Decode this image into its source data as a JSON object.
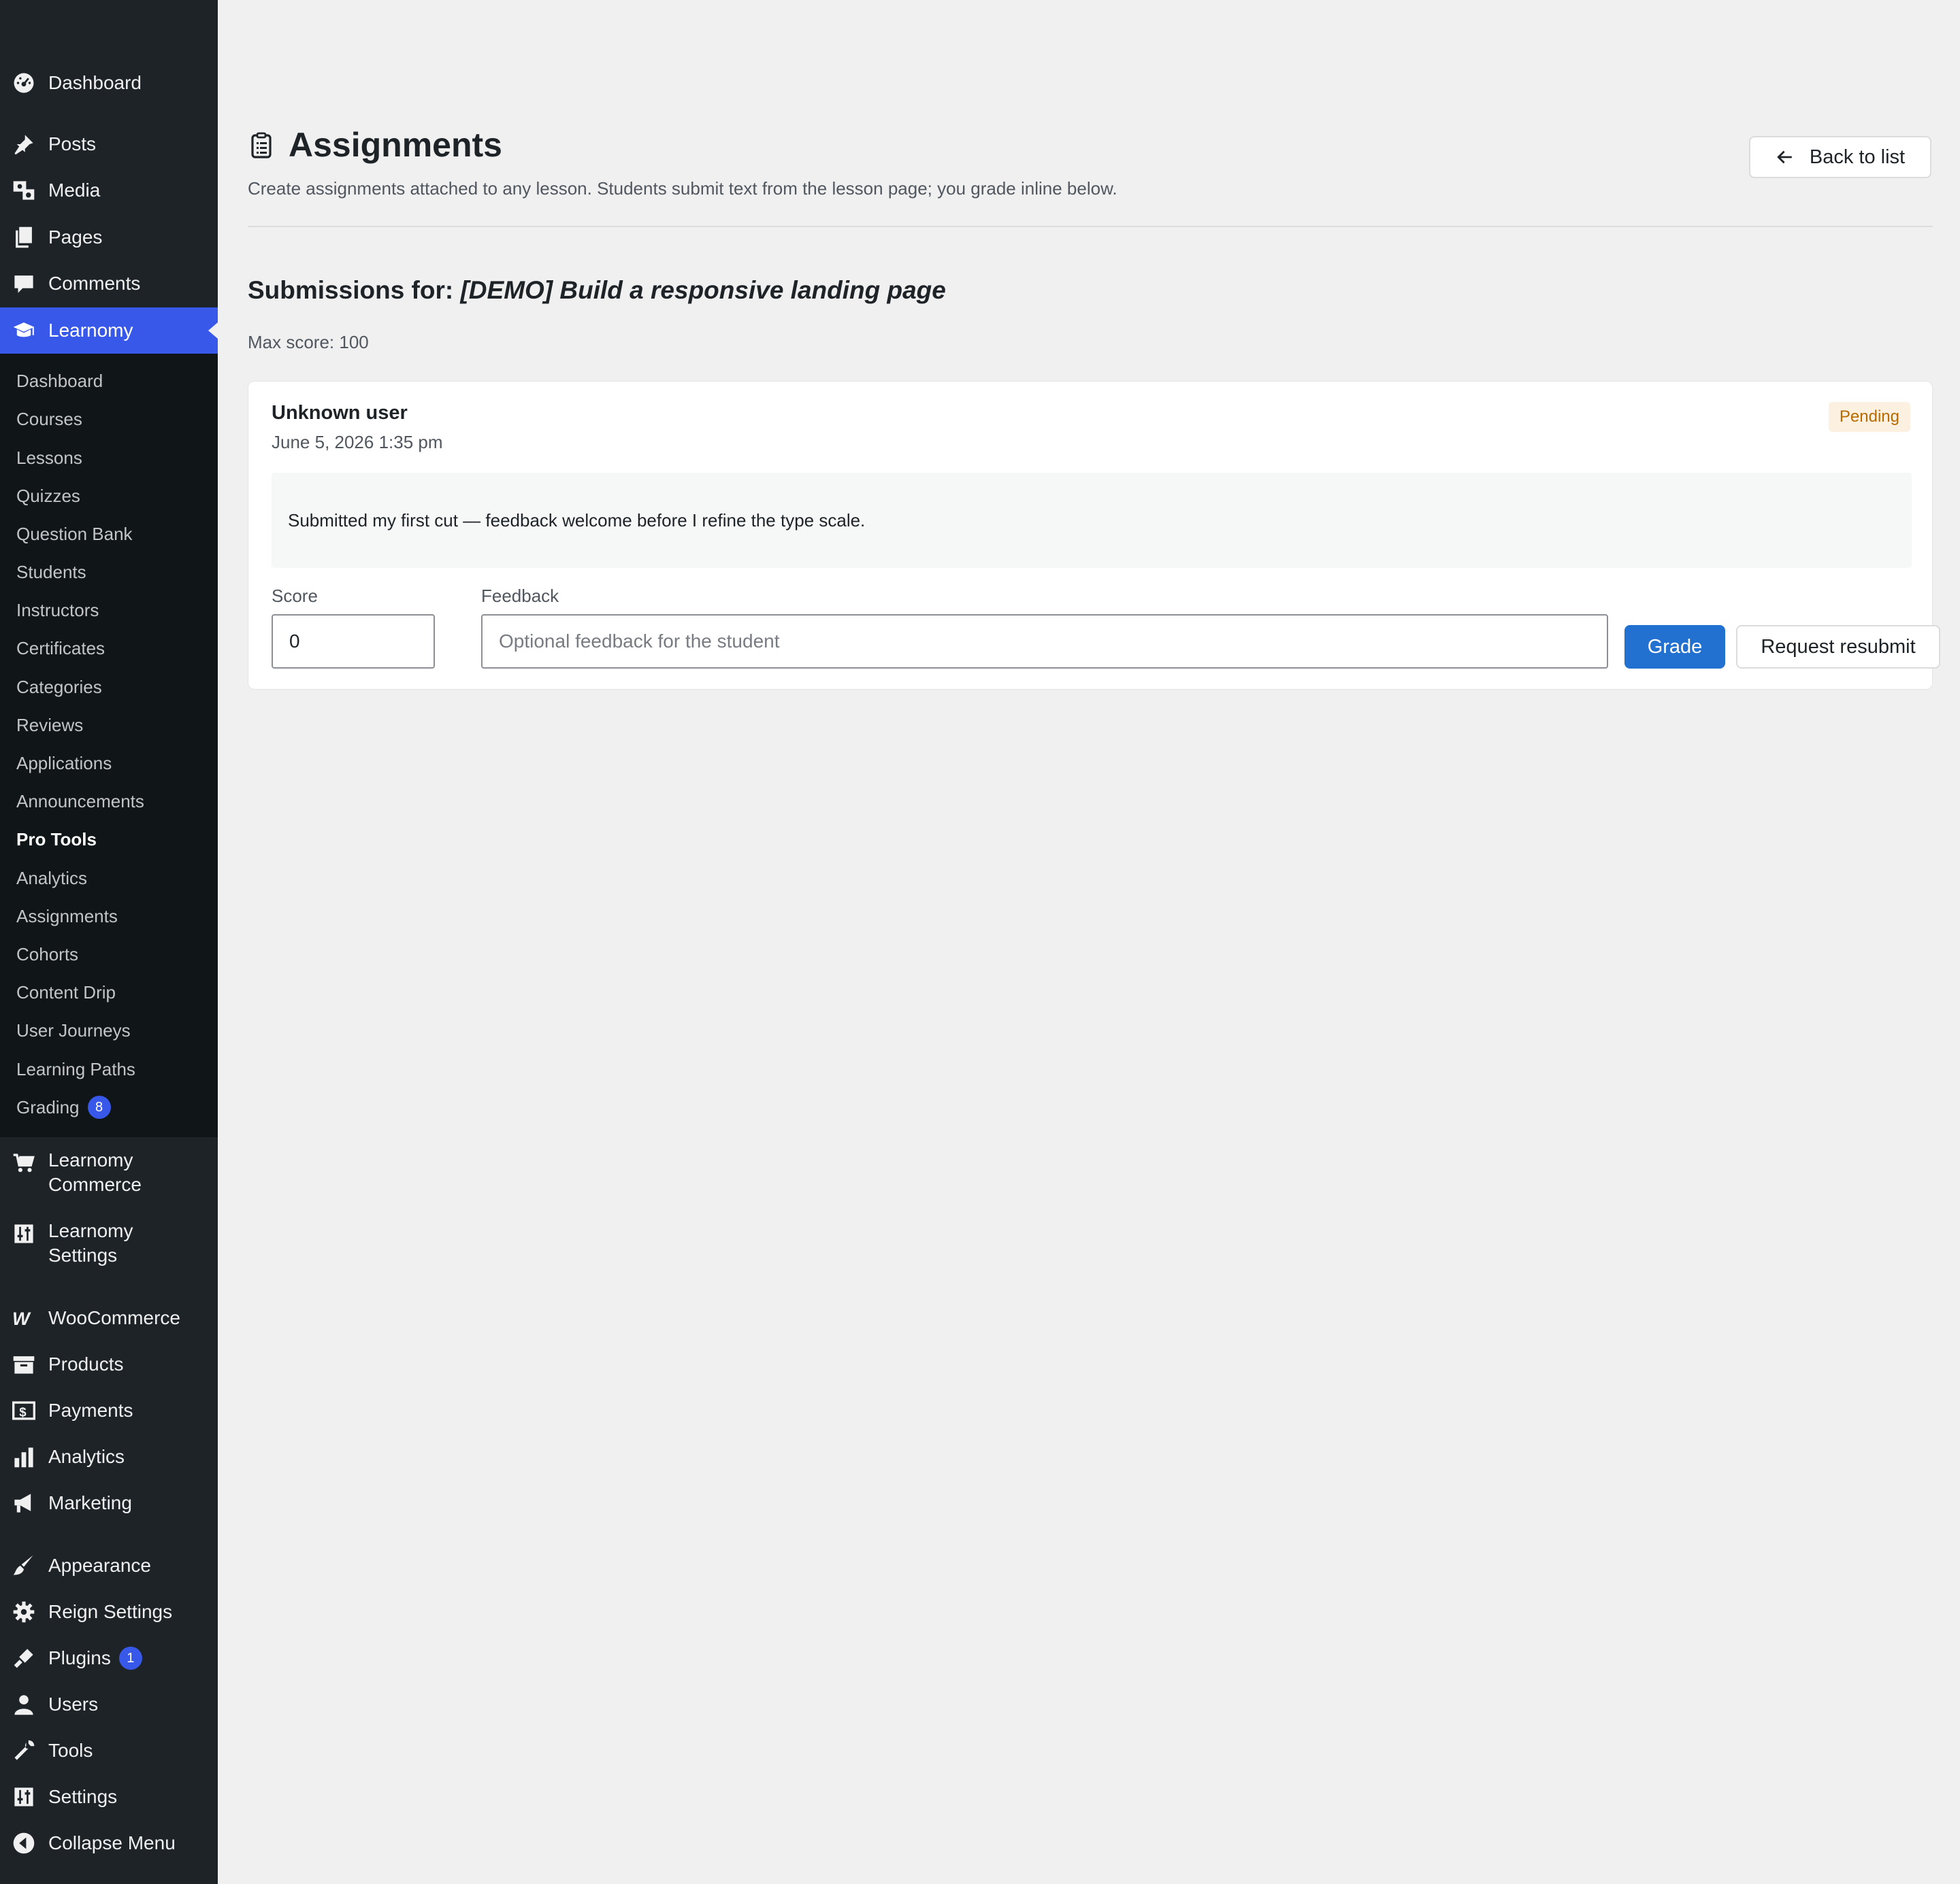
{
  "sidebar": {
    "top_items": [
      {
        "label": "Dashboard",
        "icon": "dashboard-icon"
      },
      {
        "label": "Posts",
        "icon": "pin-icon"
      },
      {
        "label": "Media",
        "icon": "media-icon"
      },
      {
        "label": "Pages",
        "icon": "pages-icon"
      },
      {
        "label": "Comments",
        "icon": "comment-icon"
      },
      {
        "label": "Learnomy",
        "icon": "graduation-cap-icon"
      }
    ],
    "learnomy_submenu": [
      "Dashboard",
      "Courses",
      "Lessons",
      "Quizzes",
      "Question Bank",
      "Students",
      "Instructors",
      "Certificates",
      "Categories",
      "Reviews",
      "Applications",
      "Announcements",
      "Pro Tools",
      "Analytics",
      "Assignments",
      "Cohorts",
      "Content Drip",
      "User Journeys",
      "Learning Paths",
      "Grading"
    ],
    "grading_badge": "8",
    "lower_items": [
      {
        "label": "Learnomy Commerce",
        "icon": "cart-icon"
      },
      {
        "label": "Learnomy Settings",
        "icon": "settings-sliders-icon"
      },
      {
        "label": "WooCommerce",
        "icon": "woocommerce-icon"
      },
      {
        "label": "Products",
        "icon": "archive-icon"
      },
      {
        "label": "Payments",
        "icon": "dollar-icon"
      },
      {
        "label": "Analytics",
        "icon": "bar-chart-icon"
      },
      {
        "label": "Marketing",
        "icon": "megaphone-icon"
      },
      {
        "label": "Appearance",
        "icon": "brush-icon"
      },
      {
        "label": "Reign Settings",
        "icon": "gear-icon"
      },
      {
        "label": "Plugins",
        "icon": "plug-icon"
      },
      {
        "label": "Users",
        "icon": "user-icon"
      },
      {
        "label": "Tools",
        "icon": "wrench-icon"
      },
      {
        "label": "Settings",
        "icon": "settings-sliders-icon"
      },
      {
        "label": "Collapse Menu",
        "icon": "collapse-icon"
      }
    ],
    "plugins_badge": "1"
  },
  "header": {
    "title": "Assignments",
    "description": "Create assignments attached to any lesson. Students submit text from the lesson page; you grade inline below.",
    "back_label": "Back to list"
  },
  "submissions": {
    "prefix": "Submissions for:",
    "assignment_title": "[DEMO] Build a responsive landing page",
    "max_score": "Max score: 100"
  },
  "submission": {
    "student": "Unknown user",
    "date": "June 5, 2026 1:35 pm",
    "status": "Pending",
    "text": "Submitted my first cut — feedback welcome before I refine the type scale.",
    "score_label": "Score",
    "score_value": "0",
    "feedback_label": "Feedback",
    "feedback_placeholder": "Optional feedback for the student",
    "grade_label": "Grade",
    "resubmit_label": "Request resubmit"
  },
  "colors": {
    "sidebar_bg": "#1d2327",
    "submenu_bg": "#101517",
    "accent": "#3858e9",
    "primary_button": "#2271d1",
    "pending": "#b86b00"
  }
}
